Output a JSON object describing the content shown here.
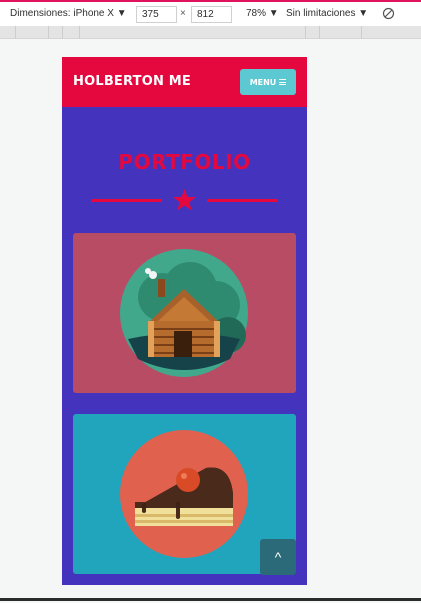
{
  "devtools": {
    "dimensions_label": "Dimensiones: iPhone X ▼",
    "width_value": "375",
    "times": "×",
    "height_value": "812",
    "zoom_label": "78% ▼",
    "throttle_label": "Sin limitaciones ▼"
  },
  "site": {
    "brand": "HOLBERTON ME",
    "menu_label": "MENU",
    "section_title": "PORTFOLIO",
    "scroll_top_icon": "^"
  },
  "colors": {
    "nav": "#e5083e",
    "page_bg": "#4434bd",
    "accent_cyan": "#5bc8d2",
    "card1": "#b84c65",
    "card2": "#21a5bd"
  },
  "icons": [
    "log-cabin-icon",
    "cake-slice-icon",
    "star-icon",
    "chevron-up-icon",
    "hamburger-icon",
    "rotate-icon"
  ]
}
